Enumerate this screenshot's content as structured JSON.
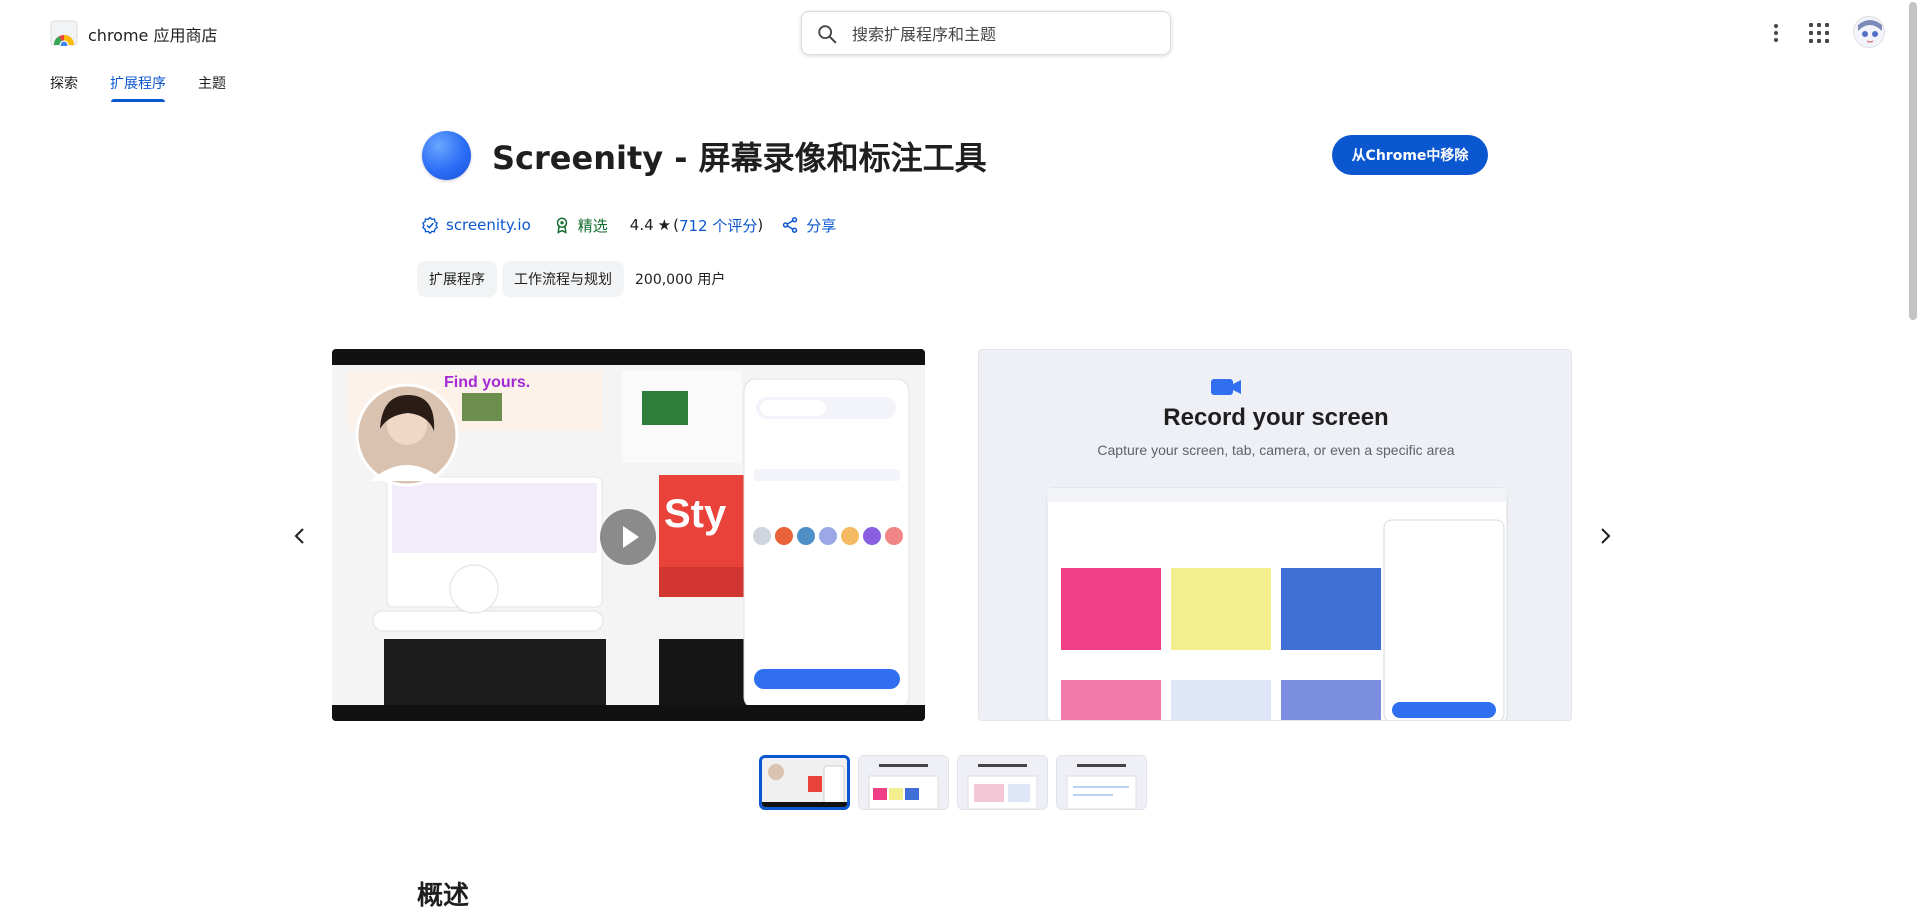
{
  "header": {
    "brand": "chrome 应用商店",
    "search_placeholder": "搜索扩展程序和主题"
  },
  "nav": {
    "tabs": [
      {
        "label": "探索"
      },
      {
        "label": "扩展程序"
      },
      {
        "label": "主题"
      }
    ]
  },
  "extension": {
    "title": "Screenity - 屏幕录像和标注工具",
    "remove_label": "从Chrome中移除",
    "developer": "screenity.io",
    "featured": "精选",
    "rating": "4.4",
    "reviews": "712 个评分",
    "share": "分享",
    "categories": [
      "扩展程序",
      "工作流程与规划"
    ],
    "users": "200,000 用户"
  },
  "carousel": {
    "slide2_title": "Record your screen",
    "slide2_subtitle": "Capture your screen, tab, camera, or even a specific area"
  },
  "overview_heading": "概述",
  "colors": {
    "accent": "#0b57d0",
    "featured": "#146c2e"
  }
}
